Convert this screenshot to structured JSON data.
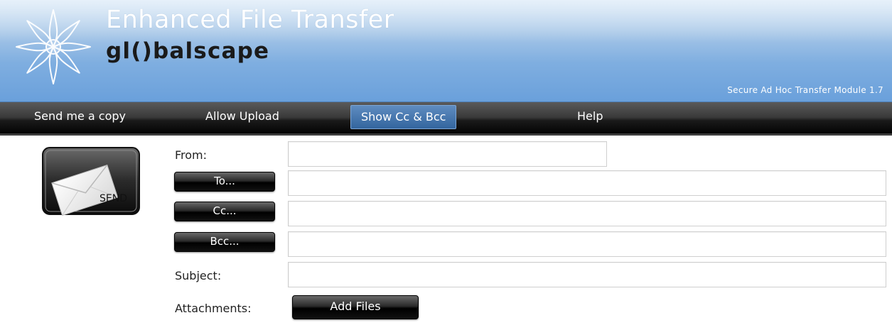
{
  "app": {
    "product_title": "Enhanced File Transfer",
    "brand": "gl()balscape",
    "module_version": "Secure Ad Hoc Transfer Module 1.7",
    "logo_icon": "starburst-logo-icon"
  },
  "menu": {
    "items": [
      {
        "label": "Send me a copy",
        "active": false
      },
      {
        "label": "Allow Upload",
        "active": false
      },
      {
        "label": "Show Cc & Bcc",
        "active": true
      },
      {
        "label": "Help",
        "active": false
      }
    ]
  },
  "send_button": {
    "label": "SEND",
    "icon": "envelope-icon"
  },
  "form": {
    "from_label": "From:",
    "from_value": "",
    "to_button": "To...",
    "to_value": "",
    "cc_button": "Cc...",
    "cc_value": "",
    "bcc_button": "Bcc...",
    "bcc_value": "",
    "subject_label": "Subject:",
    "subject_value": "",
    "attachments_label": "Attachments:",
    "add_files_button": "Add Files"
  },
  "colors": {
    "header_blue": "#7faee0",
    "menubar_black": "#000000",
    "active_menu_blue": "#33659e"
  }
}
